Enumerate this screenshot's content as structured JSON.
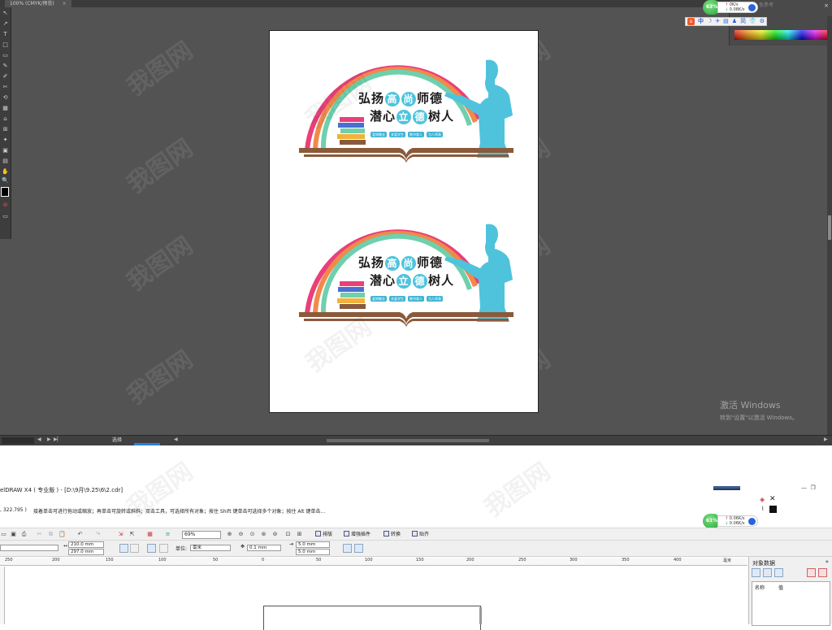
{
  "illustrator": {
    "tab_title": "100% (CMYK/预览)",
    "tab_close": "×",
    "tools": [
      "↖",
      "↗",
      "T",
      "□",
      "▭",
      "✎",
      "✐",
      "✂",
      "⟲",
      "▦",
      "⌂",
      "⊞",
      "✦",
      "▣",
      "▤",
      "◉",
      "⊕",
      "≡",
      "⬚",
      "✋",
      "🔍"
    ],
    "status_zoom": "",
    "status_tool": "选择",
    "color_panel": {
      "label1": "色参考",
      "close": "×"
    },
    "spectrum_colors": [
      "#ff0000",
      "#ff9900",
      "#ffff00",
      "#00ff00",
      "#00ffff",
      "#0000ff",
      "#ff00ff"
    ]
  },
  "net_widget_top": {
    "percent": "63%",
    "up": "0K/s",
    "down": "0.08K/s"
  },
  "net_widget_bottom": {
    "percent": "61%",
    "up": "0.06K/s",
    "down": "0.06K/s"
  },
  "ime": {
    "logo": "s",
    "mode": "中",
    "icons": [
      "☽",
      "✈",
      "▤",
      "♟",
      "简",
      "👕",
      "⚙"
    ]
  },
  "design": {
    "line1_pre": "弘扬",
    "line1_c1": "高",
    "line1_c2": "尚",
    "line1_post": "师德",
    "line2_pre": "潜心",
    "line2_c1": "立",
    "line2_c2": "德",
    "line2_post": "树人",
    "tags": [
      "爱岗敬业",
      "关爱学生",
      "教书育人",
      "为人师表"
    ],
    "colors": {
      "pink": "#e9407a",
      "orange": "#f08a4b",
      "teal": "#6fcfae",
      "blue": "#4fc3dc",
      "brown": "#8a5a3a"
    }
  },
  "watermark": "我图网",
  "windows_activation": {
    "line1": "激活 Windows",
    "line2": "转到\"设置\"以激活 Windows。"
  },
  "coreldraw": {
    "title": "elDRAW X4 ( 专业版 ) - [D:\\9月\\9.25\\6\\2.cdr]",
    "coords": ", 322.795 )",
    "hint": "接着单击可进行拖动或缩放；再单击可旋转或斜斜；双击工具，可选择所有对象；按住 Shift 键单击可选择多个对象；按住 Alt 键单击...",
    "zoom": "69%",
    "buttons": {
      "arrange": "排版",
      "plugins": "增强插件",
      "convert": "转换",
      "paste": "贴齐"
    },
    "width": "210.0 mm",
    "height": "297.0 mm",
    "unit_label": "单位:",
    "unit_value": "毫米",
    "nudge": "0.1 mm",
    "dup_x": "5.0 mm",
    "dup_y": "5.0 mm",
    "ruler": [
      "250",
      "200",
      "150",
      "100",
      "50",
      "0",
      "50",
      "100",
      "150",
      "200",
      "250",
      "300",
      "350",
      "400"
    ],
    "ruler_unit": "毫米",
    "docker": {
      "title": "对象数据",
      "expand": "»",
      "col_name": "名称",
      "col_value": "值"
    }
  }
}
